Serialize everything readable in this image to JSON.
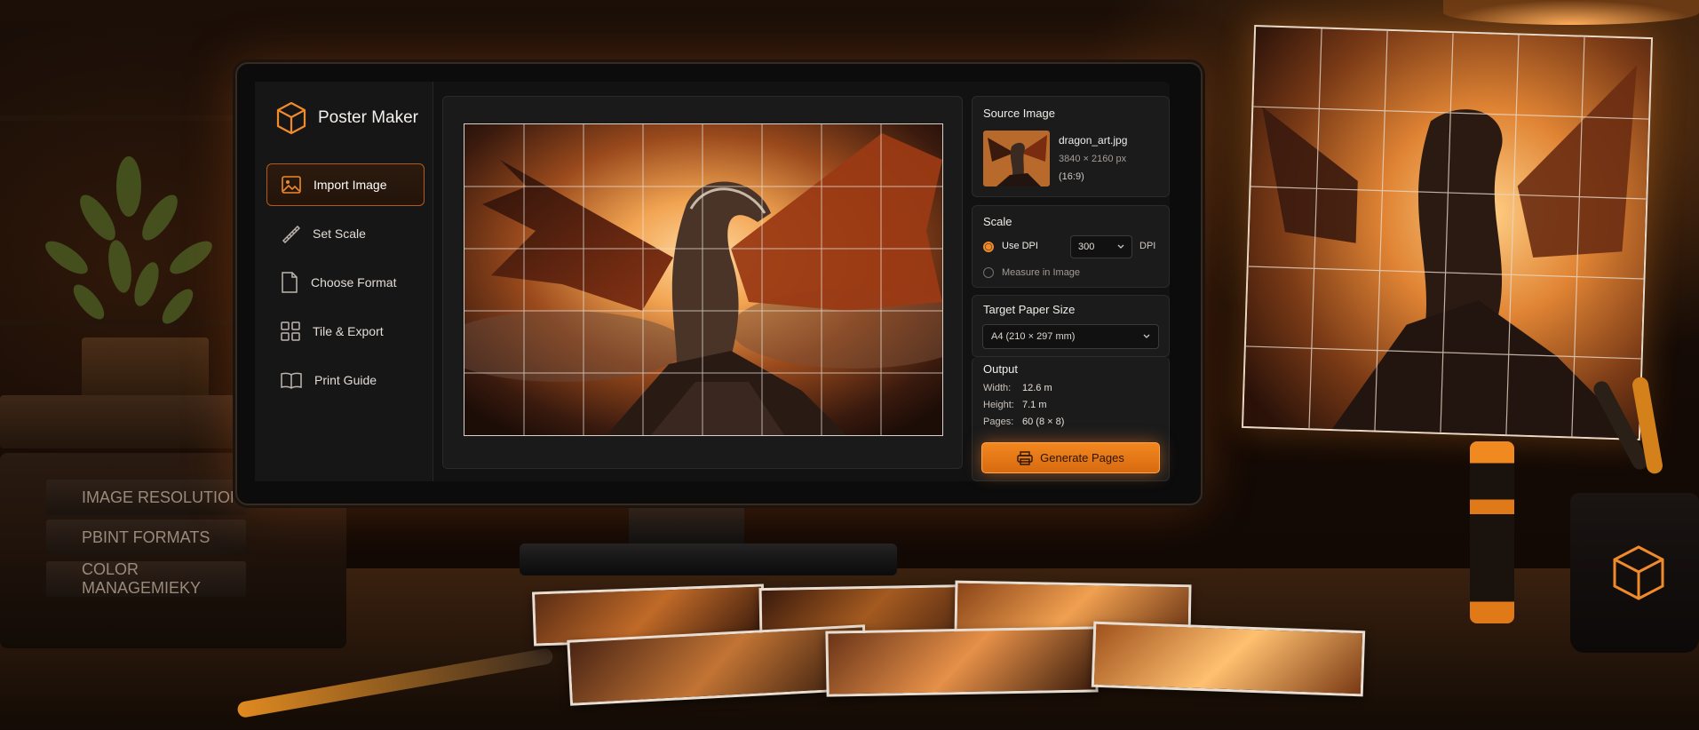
{
  "app": {
    "name": "Poster Maker"
  },
  "sidebar": {
    "items": [
      {
        "label": "Import Image",
        "icon": "image-icon",
        "active": true
      },
      {
        "label": "Set Scale",
        "icon": "ruler-icon",
        "active": false
      },
      {
        "label": "Choose Format",
        "icon": "document-icon",
        "active": false
      },
      {
        "label": "Tile & Export",
        "icon": "grid-icon",
        "active": false
      },
      {
        "label": "Print Guide",
        "icon": "book-icon",
        "active": false
      }
    ]
  },
  "source_image": {
    "title": "Source Image",
    "filename": "dragon_art.jpg",
    "dimensions": "3840 × 2160 px",
    "aspect": "(16:9)"
  },
  "scale": {
    "title": "Scale",
    "option_dpi": "Use DPI",
    "dpi_value": "300",
    "dpi_unit": "DPI",
    "option_measure": "Measure in Image",
    "selected": "Use DPI"
  },
  "paper": {
    "title": "Target Paper Size",
    "selected": "A4 (210 × 297 mm)"
  },
  "output": {
    "title": "Output",
    "width_label": "Width:",
    "width_value": "12.6 m",
    "height_label": "Height:",
    "height_value": "7.1 m",
    "pages_label": "Pages:",
    "pages_value": "60 (8 × 8)"
  },
  "actions": {
    "generate_label": "Generate Pages"
  },
  "books": {
    "spines": [
      "IMAGE RESOLUTION",
      "PBINT FORMATS",
      "COLOR MANAGEMIEKY"
    ]
  },
  "colors": {
    "accent": "#f08a2a",
    "panel": "#1b1b1c",
    "screen": "#121213",
    "text": "#f0ece7"
  }
}
